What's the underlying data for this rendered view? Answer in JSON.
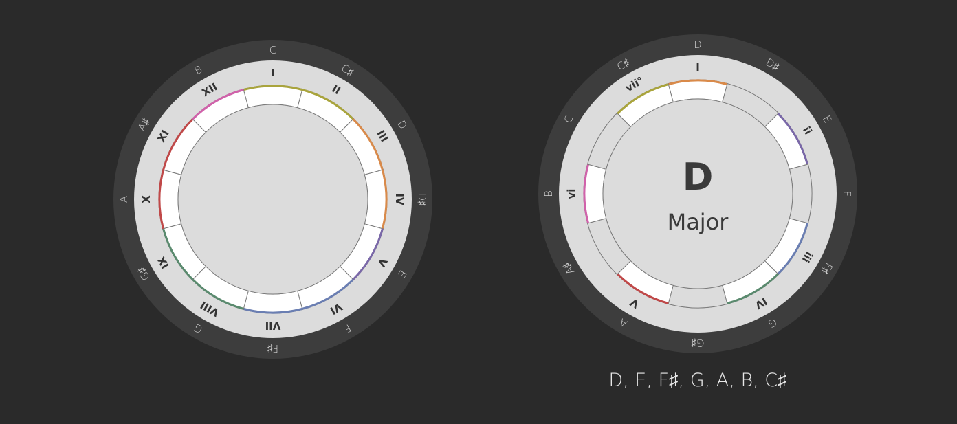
{
  "colors": {
    "background": "#2a2a2a",
    "outer_ring": "#3d3d3d",
    "inner_ring": "#dcdcdc",
    "segment_active": "#ffffff",
    "segment_inactive": "#dcdcdc",
    "text_dark": "#333333"
  },
  "chromatic_wheel": {
    "notes": [
      "C",
      "C♯",
      "D",
      "D♯",
      "E",
      "F",
      "F♯",
      "G",
      "G♯",
      "A",
      "A♯",
      "B"
    ],
    "degrees": [
      "I",
      "II",
      "III",
      "IV",
      "V",
      "VI",
      "VII",
      "VIII",
      "IX",
      "X",
      "XI",
      "XII"
    ],
    "segment_colors": [
      "#a9a43c",
      "#a9a43c",
      "#d98a4a",
      "#d98a4a",
      "#7a68a8",
      "#6a7eb2",
      "#6a7eb2",
      "#5a8a6e",
      "#5a8a6e",
      "#c04848",
      "#c04848",
      "#d062aa"
    ]
  },
  "key_wheel": {
    "notes": [
      "D",
      "D♯",
      "E",
      "F",
      "F♯",
      "G",
      "G♯",
      "A",
      "A♯",
      "B",
      "C",
      "C♯"
    ],
    "degrees": [
      "I",
      "",
      "ii",
      "",
      "iii",
      "IV",
      "",
      "V",
      "",
      "vi",
      "",
      "vii°"
    ],
    "segment_colors": [
      "#d98a4a",
      "",
      "#7a68a8",
      "",
      "#6a7eb2",
      "#5a8a6e",
      "",
      "#c04848",
      "",
      "#d062aa",
      "",
      "#a9a43c"
    ],
    "tonic": "D",
    "mode": "Major",
    "scale_notes": "D, E, F♯, G, A, B, C♯"
  }
}
